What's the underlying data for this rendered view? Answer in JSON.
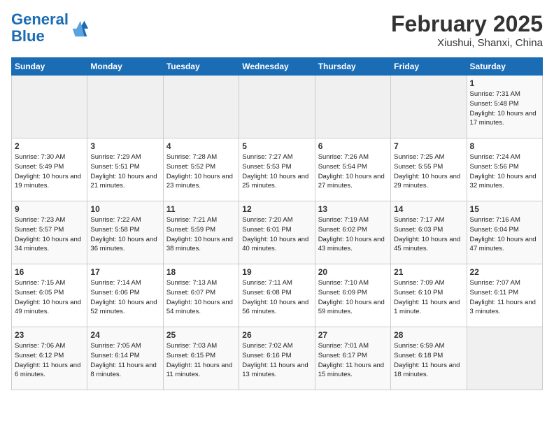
{
  "header": {
    "logo_line1": "General",
    "logo_line2": "Blue",
    "title": "February 2025",
    "subtitle": "Xiushui, Shanxi, China"
  },
  "days_of_week": [
    "Sunday",
    "Monday",
    "Tuesday",
    "Wednesday",
    "Thursday",
    "Friday",
    "Saturday"
  ],
  "weeks": [
    [
      {
        "day": "",
        "info": ""
      },
      {
        "day": "",
        "info": ""
      },
      {
        "day": "",
        "info": ""
      },
      {
        "day": "",
        "info": ""
      },
      {
        "day": "",
        "info": ""
      },
      {
        "day": "",
        "info": ""
      },
      {
        "day": "1",
        "info": "Sunrise: 7:31 AM\nSunset: 5:48 PM\nDaylight: 10 hours\nand 17 minutes."
      }
    ],
    [
      {
        "day": "2",
        "info": "Sunrise: 7:30 AM\nSunset: 5:49 PM\nDaylight: 10 hours\nand 19 minutes."
      },
      {
        "day": "3",
        "info": "Sunrise: 7:29 AM\nSunset: 5:51 PM\nDaylight: 10 hours\nand 21 minutes."
      },
      {
        "day": "4",
        "info": "Sunrise: 7:28 AM\nSunset: 5:52 PM\nDaylight: 10 hours\nand 23 minutes."
      },
      {
        "day": "5",
        "info": "Sunrise: 7:27 AM\nSunset: 5:53 PM\nDaylight: 10 hours\nand 25 minutes."
      },
      {
        "day": "6",
        "info": "Sunrise: 7:26 AM\nSunset: 5:54 PM\nDaylight: 10 hours\nand 27 minutes."
      },
      {
        "day": "7",
        "info": "Sunrise: 7:25 AM\nSunset: 5:55 PM\nDaylight: 10 hours\nand 29 minutes."
      },
      {
        "day": "8",
        "info": "Sunrise: 7:24 AM\nSunset: 5:56 PM\nDaylight: 10 hours\nand 32 minutes."
      }
    ],
    [
      {
        "day": "9",
        "info": "Sunrise: 7:23 AM\nSunset: 5:57 PM\nDaylight: 10 hours\nand 34 minutes."
      },
      {
        "day": "10",
        "info": "Sunrise: 7:22 AM\nSunset: 5:58 PM\nDaylight: 10 hours\nand 36 minutes."
      },
      {
        "day": "11",
        "info": "Sunrise: 7:21 AM\nSunset: 5:59 PM\nDaylight: 10 hours\nand 38 minutes."
      },
      {
        "day": "12",
        "info": "Sunrise: 7:20 AM\nSunset: 6:01 PM\nDaylight: 10 hours\nand 40 minutes."
      },
      {
        "day": "13",
        "info": "Sunrise: 7:19 AM\nSunset: 6:02 PM\nDaylight: 10 hours\nand 43 minutes."
      },
      {
        "day": "14",
        "info": "Sunrise: 7:17 AM\nSunset: 6:03 PM\nDaylight: 10 hours\nand 45 minutes."
      },
      {
        "day": "15",
        "info": "Sunrise: 7:16 AM\nSunset: 6:04 PM\nDaylight: 10 hours\nand 47 minutes."
      }
    ],
    [
      {
        "day": "16",
        "info": "Sunrise: 7:15 AM\nSunset: 6:05 PM\nDaylight: 10 hours\nand 49 minutes."
      },
      {
        "day": "17",
        "info": "Sunrise: 7:14 AM\nSunset: 6:06 PM\nDaylight: 10 hours\nand 52 minutes."
      },
      {
        "day": "18",
        "info": "Sunrise: 7:13 AM\nSunset: 6:07 PM\nDaylight: 10 hours\nand 54 minutes."
      },
      {
        "day": "19",
        "info": "Sunrise: 7:11 AM\nSunset: 6:08 PM\nDaylight: 10 hours\nand 56 minutes."
      },
      {
        "day": "20",
        "info": "Sunrise: 7:10 AM\nSunset: 6:09 PM\nDaylight: 10 hours\nand 59 minutes."
      },
      {
        "day": "21",
        "info": "Sunrise: 7:09 AM\nSunset: 6:10 PM\nDaylight: 11 hours\nand 1 minute."
      },
      {
        "day": "22",
        "info": "Sunrise: 7:07 AM\nSunset: 6:11 PM\nDaylight: 11 hours\nand 3 minutes."
      }
    ],
    [
      {
        "day": "23",
        "info": "Sunrise: 7:06 AM\nSunset: 6:12 PM\nDaylight: 11 hours\nand 6 minutes."
      },
      {
        "day": "24",
        "info": "Sunrise: 7:05 AM\nSunset: 6:14 PM\nDaylight: 11 hours\nand 8 minutes."
      },
      {
        "day": "25",
        "info": "Sunrise: 7:03 AM\nSunset: 6:15 PM\nDaylight: 11 hours\nand 11 minutes."
      },
      {
        "day": "26",
        "info": "Sunrise: 7:02 AM\nSunset: 6:16 PM\nDaylight: 11 hours\nand 13 minutes."
      },
      {
        "day": "27",
        "info": "Sunrise: 7:01 AM\nSunset: 6:17 PM\nDaylight: 11 hours\nand 15 minutes."
      },
      {
        "day": "28",
        "info": "Sunrise: 6:59 AM\nSunset: 6:18 PM\nDaylight: 11 hours\nand 18 minutes."
      },
      {
        "day": "",
        "info": ""
      }
    ]
  ]
}
